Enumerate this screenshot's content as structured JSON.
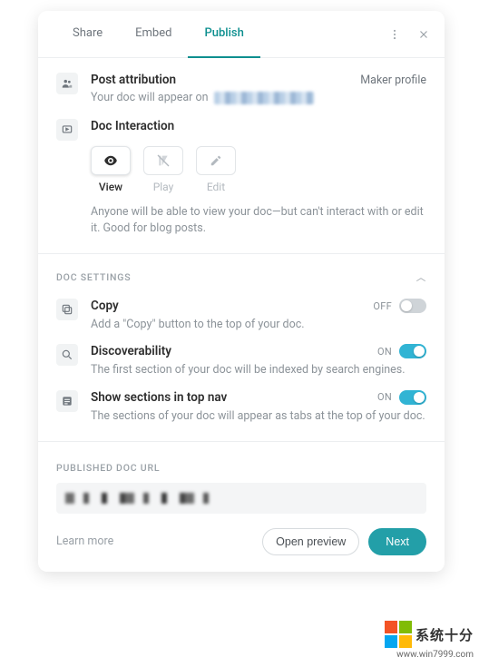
{
  "tabs": {
    "share": "Share",
    "embed": "Embed",
    "publish": "Publish"
  },
  "attribution": {
    "title": "Post attribution",
    "maker": "Maker profile",
    "appear_prefix": "Your doc will appear on"
  },
  "interaction": {
    "title": "Doc Interaction",
    "view": "View",
    "play": "Play",
    "edit": "Edit",
    "desc": "Anyone will be able to view your doc—but can't interact with or edit it. Good for blog posts."
  },
  "settings": {
    "header": "DOC SETTINGS",
    "copy": {
      "title": "Copy",
      "desc": "Add a \"Copy\" button to the top of your doc.",
      "state": "OFF"
    },
    "discover": {
      "title": "Discoverability",
      "desc": "The first section of your doc will be indexed by search engines.",
      "state": "ON"
    },
    "sections": {
      "title": "Show sections in top nav",
      "desc": "The sections of your doc will appear as tabs at the top of your doc.",
      "state": "ON"
    }
  },
  "url_label": "PUBLISHED DOC URL",
  "footer": {
    "learn": "Learn more",
    "preview": "Open preview",
    "next": "Next"
  },
  "watermark": {
    "line1": "系统十分",
    "line2": "www.win7999.com"
  }
}
